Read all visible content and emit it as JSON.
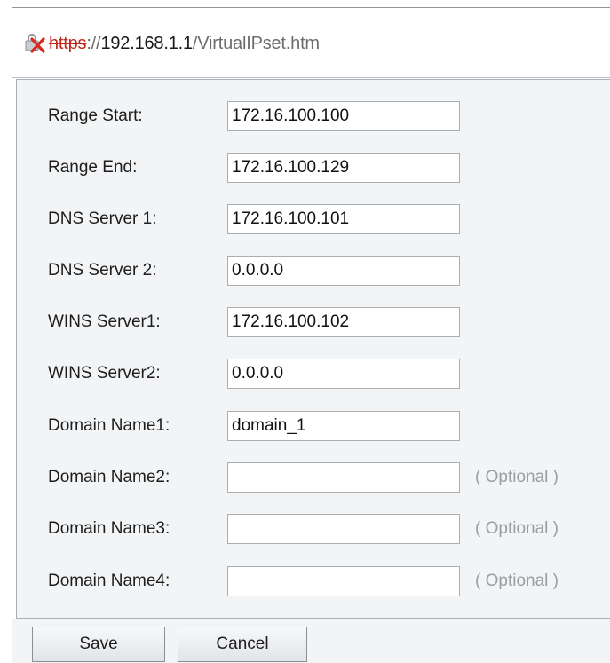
{
  "addressbar": {
    "scheme": "https",
    "separator": "://",
    "host": "192.168.1.1",
    "path": "/VirtualIPset.htm",
    "security_icon": "certificate-error-icon"
  },
  "form": {
    "fields": [
      {
        "label": "Range Start:",
        "value": "172.16.100.100",
        "note": ""
      },
      {
        "label": "Range End:",
        "value": "172.16.100.129",
        "note": ""
      },
      {
        "label": "DNS Server 1:",
        "value": "172.16.100.101",
        "note": ""
      },
      {
        "label": "DNS Server 2:",
        "value": "0.0.0.0",
        "note": ""
      },
      {
        "label": "WINS Server1:",
        "value": "172.16.100.102",
        "note": ""
      },
      {
        "label": "WINS Server2:",
        "value": "0.0.0.0",
        "note": ""
      },
      {
        "label": "Domain Name1:",
        "value": "domain_1",
        "note": ""
      },
      {
        "label": "Domain Name2:",
        "value": "",
        "note": "( Optional )"
      },
      {
        "label": "Domain Name3:",
        "value": "",
        "note": "( Optional )"
      },
      {
        "label": "Domain Name4:",
        "value": "",
        "note": "( Optional )"
      }
    ]
  },
  "buttons": {
    "save_label": "Save",
    "cancel_label": "Cancel"
  },
  "colors": {
    "error_red": "#c0281d",
    "panel_background": "#f2f4f6",
    "optional_text": "#9a9ea3"
  }
}
